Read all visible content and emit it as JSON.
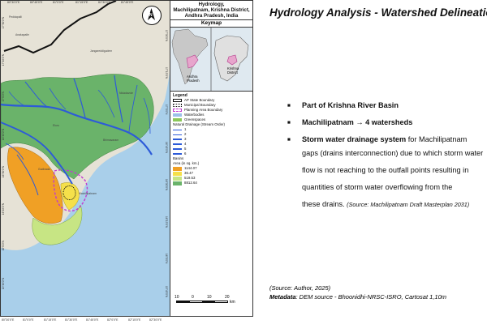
{
  "map": {
    "title_lines": [
      "Hydrology,",
      "Machilipatnam, Krishna District,",
      "Andhra Pradesh, India"
    ],
    "keymap_title": "Keymap",
    "keymap_labels": [
      "Andhra Pradesh",
      "Krishna District"
    ],
    "north_label": "N",
    "places": [
      "Peddapalli",
      "Anakapalle",
      "Jangareddigudem",
      "Eluru",
      "Nidadavole",
      "Bhimavaram",
      "Gudivada",
      "Machilipatnam"
    ],
    "legend": {
      "title": "Legend",
      "boundaries": [
        {
          "label": "AP State Boundary",
          "color": "#111111",
          "style": "solid"
        },
        {
          "label": "Municipal Boundary",
          "color": "#111111",
          "style": "dotted"
        },
        {
          "label": "Planning Area Boundary",
          "color": "#c13ad1",
          "style": "dashed"
        }
      ],
      "fills": [
        {
          "label": "Waterbodies",
          "color": "#9cc0e8"
        },
        {
          "label": "Greenspaces",
          "color": "#8cc85a"
        }
      ],
      "drainage_title": "Natural Drainage (Stream Order)",
      "stream_orders": [
        "1",
        "2",
        "3",
        "4",
        "5",
        "6"
      ],
      "basin_title": "Basins",
      "basin_subtitle": "Area (in sq. km.)",
      "basins": [
        {
          "label": "1144.07",
          "color": "#f0a025"
        },
        {
          "label": "36.47",
          "color": "#f5e04a"
        },
        {
          "label": "519.53",
          "color": "#c7e584"
        },
        {
          "label": "8812.64",
          "color": "#6ab36a"
        }
      ]
    },
    "scale": {
      "labels": [
        "10",
        "0",
        "10",
        "20"
      ],
      "unit": "km"
    },
    "ticks_bottom": [
      "80°30'0\"E",
      "81°0'0\"E",
      "81°15'0\"E",
      "81°30'0\"E",
      "81°45'0\"E",
      "82°0'0\"E",
      "82°15'0\"E",
      "82°30'0\"E"
    ],
    "ticks_top": [
      "80°30'0\"E",
      "80°45'0\"E",
      "81°0'0\"E",
      "81°15'0\"E",
      "81°30'0\"E",
      "81°45'0\"E"
    ],
    "ticks_left": [
      "17°30'0\"N",
      "17°15'0\"N",
      "17°0'0\"N",
      "16°45'0\"N",
      "16°30'0\"N",
      "16°15'0\"N",
      "16°0'0\"N",
      "15°45'0\"N"
    ],
    "ticks_right": [
      "17°30'0\"N",
      "17°15'0\"N",
      "17°0'0\"N",
      "16°45'0\"N",
      "16°30'0\"N",
      "16°15'0\"N",
      "16°0'0\"N",
      "15°45'0\"N"
    ],
    "colors": {
      "land": "#e6e2d6",
      "sea": "#a9cfea",
      "river": "#2d5bd8"
    }
  },
  "slide": {
    "title": "Hydrology Analysis - Watershed Delineation",
    "bullets": [
      {
        "bold": "Part of Krishna River Basin",
        "rest": ""
      },
      {
        "bold": "Machilipatnam →  4 watersheds",
        "rest": ""
      },
      {
        "bold": "Storm water drainage system",
        "rest": " for Machilipatnam"
      }
    ],
    "continuation_lines": [
      "gaps (drains interconnection) due to which storm water",
      "flow is not reaching to the outfall points resulting in",
      "quantities of storm water overflowing from the",
      "these drains."
    ],
    "continuation_source": "(Source: Machilipatnam Draft Masterplan 2031)",
    "source_author": "(Source: Author, 2025)",
    "metadata_label": "Metadata",
    "metadata_rest": ": DEM source - Bhoonidhi-NRSC-ISRO, Cartosat 1,10m"
  }
}
